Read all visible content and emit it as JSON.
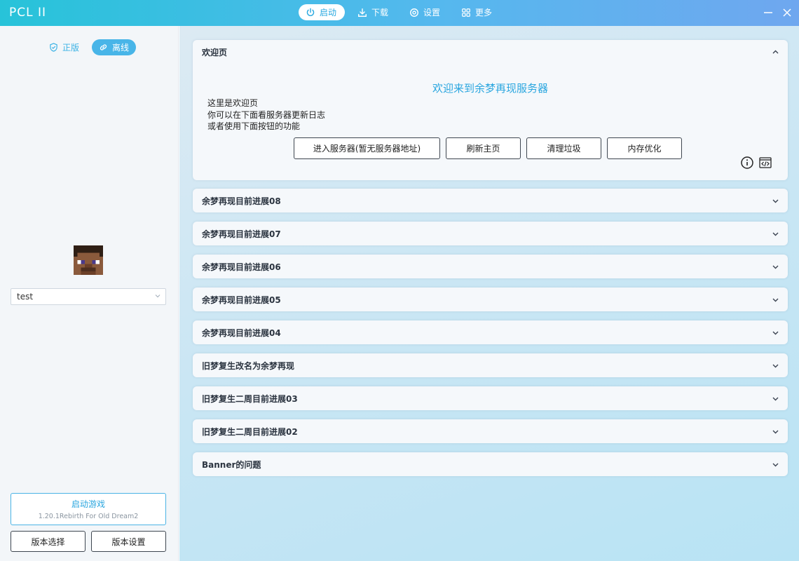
{
  "app": {
    "title": "PCL II"
  },
  "nav": {
    "tabs": [
      {
        "label": "启动",
        "icon": "power-icon",
        "active": true
      },
      {
        "label": "下载",
        "icon": "download-icon",
        "active": false
      },
      {
        "label": "设置",
        "icon": "gear-icon",
        "active": false
      },
      {
        "label": "更多",
        "icon": "grid-icon",
        "active": false
      }
    ]
  },
  "sidebar": {
    "modes": [
      {
        "label": "正版",
        "icon": "shield-icon",
        "active": false
      },
      {
        "label": "离线",
        "icon": "link-icon",
        "active": true
      }
    ],
    "username": "test",
    "launch": {
      "title": "启动游戏",
      "version": "1.20.1Rebirth For Old Dream2"
    },
    "version_select": "版本选择",
    "version_settings": "版本设置"
  },
  "welcome": {
    "header": "欢迎页",
    "title": "欢迎来到余梦再现服务器",
    "lines": [
      "这里是欢迎页",
      "你可以在下面看服务器更新日志",
      "或者使用下面按钮的功能"
    ],
    "buttons": [
      "进入服务器(暂无服务器地址)",
      "刷新主页",
      "清理垃圾",
      "内存优化"
    ]
  },
  "sections": [
    "余梦再现目前进展08",
    "余梦再现目前进展07",
    "余梦再现目前进展06",
    "余梦再现目前进展05",
    "余梦再现目前进展04",
    "旧梦复生改名为余梦再现",
    "旧梦复生二周目前进展03",
    "旧梦复生二周目前进展02",
    "Banner的问题"
  ],
  "colors": {
    "accent": "#2aa6df",
    "titlebar_start": "#27c3d9",
    "titlebar_end": "#6fa7ef"
  }
}
